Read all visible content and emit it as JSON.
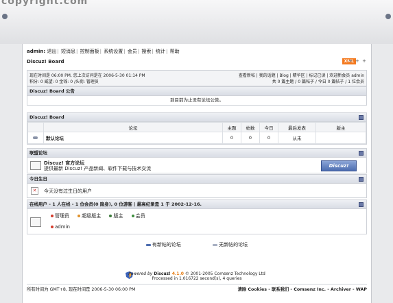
{
  "site_watermark": "copyright.com",
  "nav": {
    "user": "admin:",
    "items": [
      "退出",
      "短消息",
      "控制面板",
      "系统设置",
      "会员",
      "搜索",
      "统计",
      "帮助"
    ]
  },
  "breadcrumb": "Discuz! Board",
  "xml_label": "XML",
  "dots": "+ + +",
  "info": {
    "line1": "现在时间是 06:00 PM, 您上次访问是在 2006-5-30 01:14 PM",
    "line2": "积分: 0 威望: 0 金钱: 0 /头衔: 管理员",
    "right1": "查看新帖 | 我的话题 | Blog | 精华区 | 标记已读 | 欢迎新会员 admin",
    "right2": "共 0 篇主题 / 0 篇帖子 / 今日 0 篇帖子 / 1 位会员"
  },
  "announce": {
    "title": "Discuz! Board 公告",
    "text": "到目前为止没有论坛公告。"
  },
  "board": {
    "title": "Discuz! Board",
    "headers": [
      "论坛",
      "主题",
      "帖数",
      "今日",
      "最后发表",
      "版主"
    ],
    "rows": [
      {
        "name": "默认论坛",
        "threads": "0",
        "posts": "0",
        "today": "0",
        "last": "从未",
        "mods": ""
      }
    ]
  },
  "friends": {
    "title": "联盟论坛",
    "name": "Discuz! 官方论坛",
    "desc": "提供最新 Discuz! 产品新闻、软件下载与技术交流",
    "badge": "Discuz!"
  },
  "birthday": {
    "title": "今日生日",
    "text": "今天没有过生日的用户"
  },
  "online": {
    "title": "在线用户 - 1 人在线 - 1 位会员(0 隐身), 0 位游客 | 最高纪录是 1 于 2002-12-16.",
    "legend": [
      {
        "label": "管理员",
        "color": "#d43b2b"
      },
      {
        "label": "超级版主",
        "color": "#e0912a"
      },
      {
        "label": "版主",
        "color": "#3c7a3a"
      },
      {
        "label": "会员",
        "color": "#3e8e3e"
      }
    ],
    "user": "admin"
  },
  "legend_new": "有新帖的论坛",
  "legend_none": "无新帖的论坛",
  "footer": {
    "powered": "Powered by",
    "brand": "Discuz!",
    "version": "4.1.0",
    "copyright": "© 2001-2005 Comsenz Technology Ltd",
    "processed": "Processed in 1.016722 second(s), 4 queries"
  },
  "bottom": {
    "left": "所有时间为 GMT+8, 现在时间是 2006-5-30 06:00 PM",
    "right": "清除 Cookies - 联系我们 - Comsenz Inc. - Archiver - WAP"
  }
}
